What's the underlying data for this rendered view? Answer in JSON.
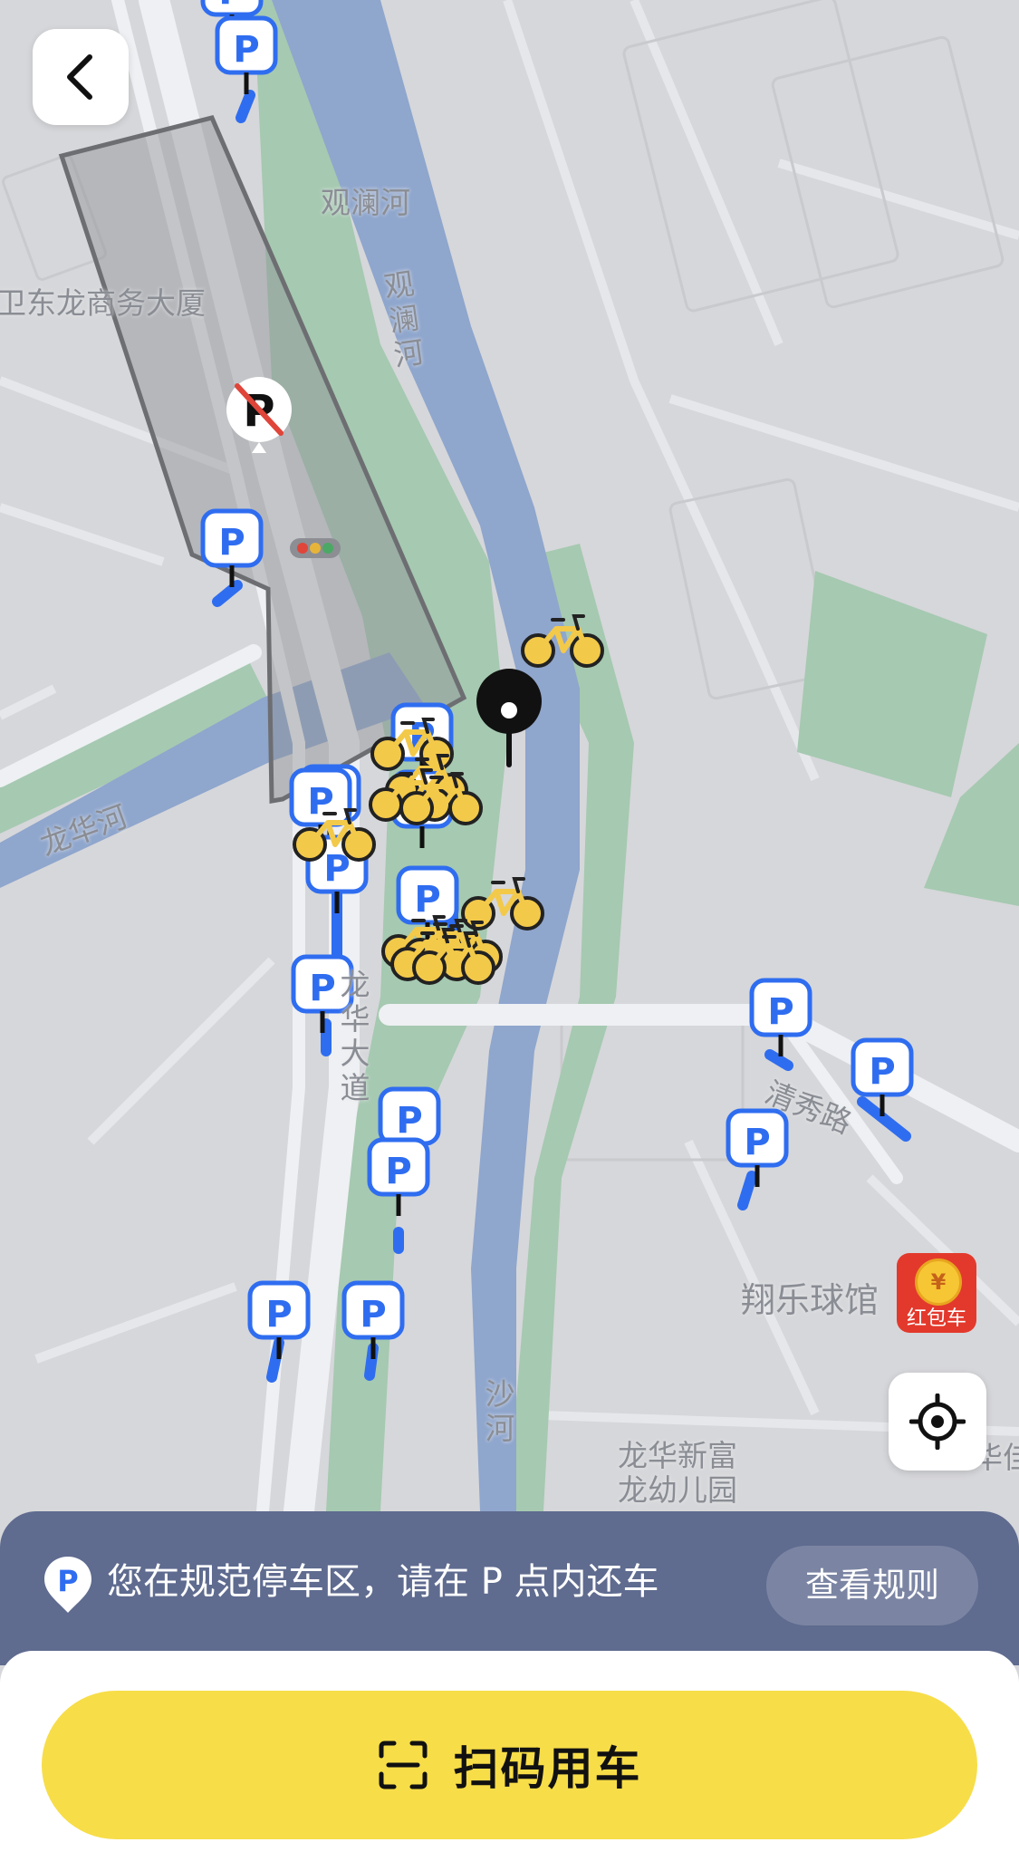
{
  "map": {
    "labels": {
      "river_guanlan_1": "观澜河",
      "river_guanlan_2": "观澜河",
      "building_donglong": "卫东龙商务大厦",
      "river_longhua": "龙华河",
      "road_longhua": "龙华大道",
      "road_qingxiu": "清秀路",
      "venue_xiangle": "翔乐球馆",
      "river_sha": "沙河",
      "school_1": "龙华新富",
      "school_2": "龙幼儿园",
      "edge_text": "华佳"
    },
    "parking_marker_letter": "P",
    "colors": {
      "land": "#d6d7da",
      "water": "#8fa6cd",
      "green": "#a6c9b1",
      "road": "#eef0f3",
      "parking_blue": "#2f6df0",
      "bike_yellow": "#f3c94a",
      "nopark_red": "#e0453a"
    }
  },
  "top": {
    "back_icon": "chevron-left-icon"
  },
  "controls": {
    "locate_icon": "crosshair-icon"
  },
  "promo": {
    "coin_symbol": "¥",
    "label": "红包车"
  },
  "banner": {
    "icon": "parking-pin-icon",
    "text": "您在规范停车区，请在 P 点内还车",
    "rules_button": "查看规则"
  },
  "bottom": {
    "scan_icon": "scan-frame-icon",
    "scan_button": "扫码用车"
  }
}
